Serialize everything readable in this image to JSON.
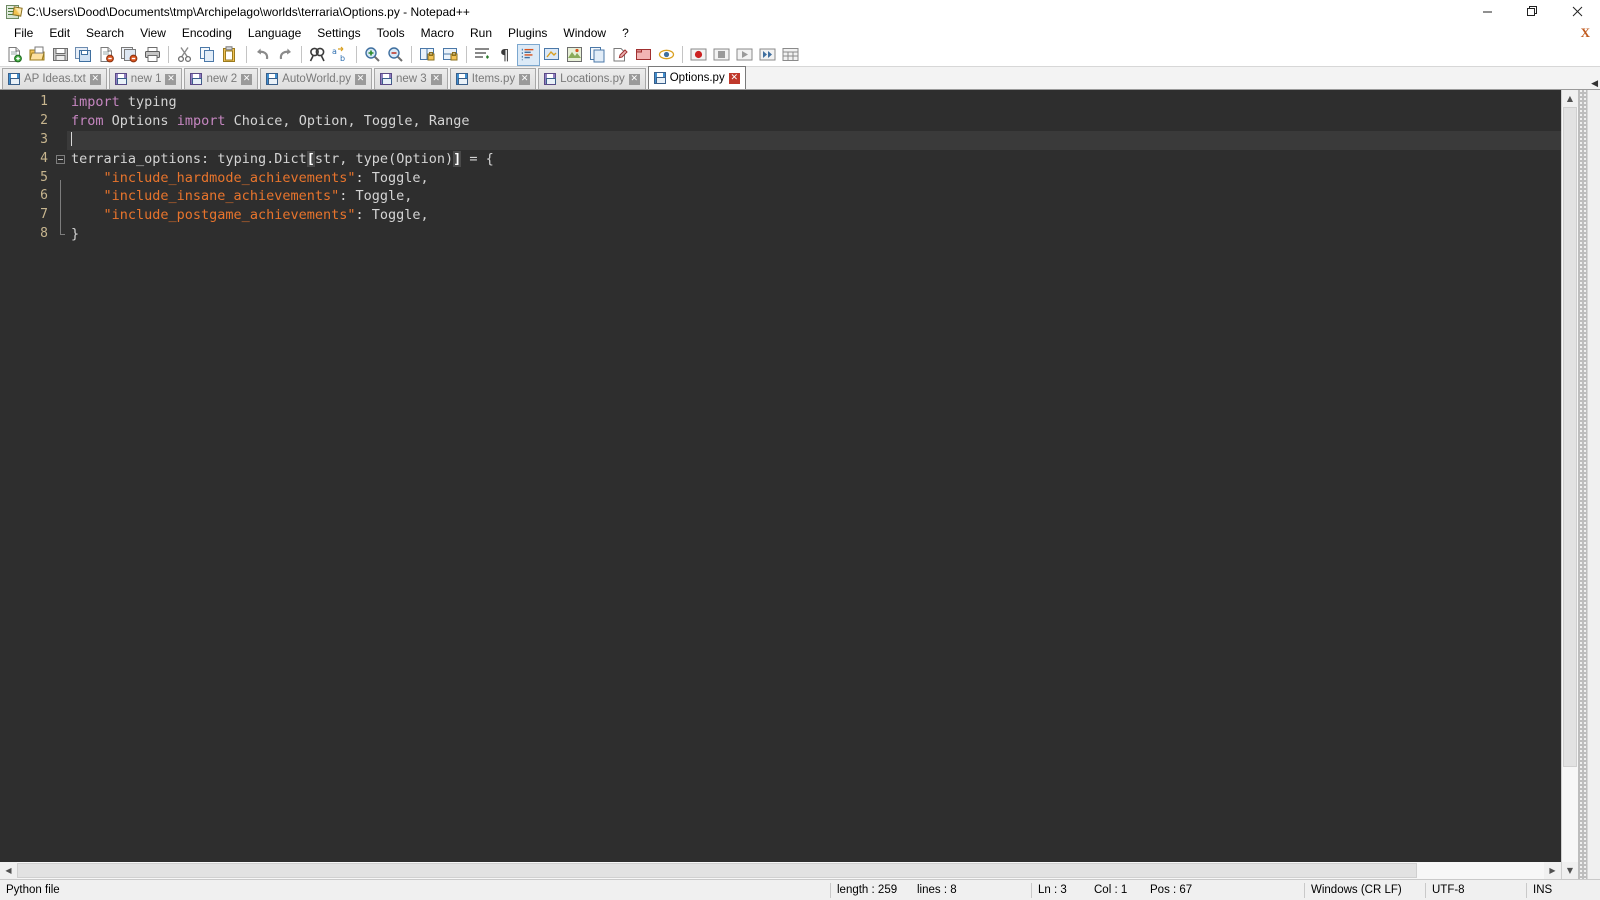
{
  "window": {
    "title": "C:\\Users\\Dood\\Documents\\tmp\\Archipelago\\worlds\\terraria\\Options.py - Notepad++",
    "app_icon": "notepad-plus-plus-icon",
    "minimize_label": "—",
    "restore_label": "❐",
    "close_label": "✕"
  },
  "menu": {
    "items": [
      {
        "label": "File"
      },
      {
        "label": "Edit"
      },
      {
        "label": "Search"
      },
      {
        "label": "View"
      },
      {
        "label": "Encoding"
      },
      {
        "label": "Language"
      },
      {
        "label": "Settings"
      },
      {
        "label": "Tools"
      },
      {
        "label": "Macro"
      },
      {
        "label": "Run"
      },
      {
        "label": "Plugins"
      },
      {
        "label": "Window"
      },
      {
        "label": "?"
      }
    ],
    "document_close_label": "X"
  },
  "toolbar": {
    "buttons": [
      {
        "name": "new-file-icon",
        "tooltip": "New"
      },
      {
        "name": "open-file-icon",
        "tooltip": "Open"
      },
      {
        "name": "save-icon",
        "tooltip": "Save"
      },
      {
        "name": "save-all-icon",
        "tooltip": "Save All"
      },
      {
        "name": "close-file-icon",
        "tooltip": "Close"
      },
      {
        "name": "close-all-files-icon",
        "tooltip": "Close All"
      },
      {
        "name": "print-icon",
        "tooltip": "Print"
      },
      {
        "name": "separator",
        "tooltip": ""
      },
      {
        "name": "cut-icon",
        "tooltip": "Cut"
      },
      {
        "name": "copy-icon",
        "tooltip": "Copy"
      },
      {
        "name": "paste-icon",
        "tooltip": "Paste"
      },
      {
        "name": "separator",
        "tooltip": ""
      },
      {
        "name": "undo-icon",
        "tooltip": "Undo"
      },
      {
        "name": "redo-icon",
        "tooltip": "Redo"
      },
      {
        "name": "separator",
        "tooltip": ""
      },
      {
        "name": "find-icon",
        "tooltip": "Find"
      },
      {
        "name": "replace-icon",
        "tooltip": "Replace"
      },
      {
        "name": "separator",
        "tooltip": ""
      },
      {
        "name": "zoom-in-icon",
        "tooltip": "Zoom In"
      },
      {
        "name": "zoom-out-icon",
        "tooltip": "Zoom Out"
      },
      {
        "name": "separator",
        "tooltip": ""
      },
      {
        "name": "sync-vertical-scroll-icon",
        "tooltip": "Synchronize Vertical Scrolling"
      },
      {
        "name": "sync-horizontal-scroll-icon",
        "tooltip": "Synchronize Horizontal Scrolling"
      },
      {
        "name": "separator",
        "tooltip": ""
      },
      {
        "name": "word-wrap-icon",
        "tooltip": "Word wrap"
      },
      {
        "name": "show-all-characters-icon",
        "tooltip": "Show All Characters"
      },
      {
        "name": "show-indent-guide-icon",
        "tooltip": "Show Indent Guide"
      },
      {
        "name": "user-defined-language-icon",
        "tooltip": "User-Defined Dialogue"
      },
      {
        "name": "document-map-icon",
        "tooltip": "Document Map"
      },
      {
        "name": "function-list-icon",
        "tooltip": "Function List"
      },
      {
        "name": "folder-as-workspace-icon",
        "tooltip": "Folder as Workspace"
      },
      {
        "name": "monitoring-icon",
        "tooltip": "Monitoring"
      },
      {
        "name": "separator",
        "tooltip": ""
      },
      {
        "name": "macro-record-icon",
        "tooltip": "Start Recording"
      },
      {
        "name": "macro-stop-icon",
        "tooltip": "Stop Recording"
      },
      {
        "name": "macro-play-icon",
        "tooltip": "Playback"
      },
      {
        "name": "macro-run-multiple-icon",
        "tooltip": "Run a Macro Multiple Times"
      },
      {
        "name": "macro-save-icon",
        "tooltip": "Save Current Recorded Macro"
      }
    ]
  },
  "tabs": {
    "items": [
      {
        "label": "AP Ideas.txt",
        "icon": "save-blue-icon",
        "active": false,
        "modified": false
      },
      {
        "label": "new 1",
        "icon": "save-purple-icon",
        "active": false,
        "modified": true
      },
      {
        "label": "new 2",
        "icon": "save-purple-icon",
        "active": false,
        "modified": true
      },
      {
        "label": "AutoWorld.py",
        "icon": "save-blue-icon",
        "active": false,
        "modified": false
      },
      {
        "label": "new 3",
        "icon": "save-purple-icon",
        "active": false,
        "modified": true
      },
      {
        "label": "Items.py",
        "icon": "save-blue-icon",
        "active": false,
        "modified": false
      },
      {
        "label": "Locations.py",
        "icon": "save-purple-icon",
        "active": false,
        "modified": false
      },
      {
        "label": "Options.py",
        "icon": "save-blue-icon",
        "active": true,
        "modified": false
      }
    ],
    "close_glyph": "✕",
    "scroll_left_glyph": "◀",
    "scroll_right_glyph": "▶"
  },
  "editor": {
    "line_numbers": [
      "1",
      "2",
      "3",
      "4",
      "5",
      "6",
      "7",
      "8"
    ],
    "current_line": 3,
    "fold_start_line": 4,
    "fold_end_line": 7,
    "lines": [
      {
        "n": 1,
        "tokens": [
          {
            "t": "import",
            "c": "kw"
          },
          {
            "t": " ",
            "c": "op"
          },
          {
            "t": "typing",
            "c": "id"
          }
        ]
      },
      {
        "n": 2,
        "tokens": [
          {
            "t": "from",
            "c": "kw"
          },
          {
            "t": " ",
            "c": "op"
          },
          {
            "t": "Options",
            "c": "id"
          },
          {
            "t": " ",
            "c": "op"
          },
          {
            "t": "import",
            "c": "kw"
          },
          {
            "t": " ",
            "c": "op"
          },
          {
            "t": "Choice",
            "c": "id"
          },
          {
            "t": ",",
            "c": "op"
          },
          {
            "t": " ",
            "c": "op"
          },
          {
            "t": "Option",
            "c": "id"
          },
          {
            "t": ",",
            "c": "op"
          },
          {
            "t": " ",
            "c": "op"
          },
          {
            "t": "Toggle",
            "c": "id"
          },
          {
            "t": ",",
            "c": "op"
          },
          {
            "t": " ",
            "c": "op"
          },
          {
            "t": "Range",
            "c": "id"
          }
        ]
      },
      {
        "n": 3,
        "tokens": []
      },
      {
        "n": 4,
        "tokens": [
          {
            "t": "terraria_options",
            "c": "id"
          },
          {
            "t": ": ",
            "c": "op"
          },
          {
            "t": "typing",
            "c": "id"
          },
          {
            "t": ".",
            "c": "op"
          },
          {
            "t": "Dict",
            "c": "id"
          },
          {
            "t": "[",
            "c": "br"
          },
          {
            "t": "str",
            "c": "id"
          },
          {
            "t": ", ",
            "c": "op"
          },
          {
            "t": "type",
            "c": "id"
          },
          {
            "t": "(",
            "c": "op"
          },
          {
            "t": "Option",
            "c": "id"
          },
          {
            "t": ")",
            "c": "op"
          },
          {
            "t": "]",
            "c": "br"
          },
          {
            "t": " = {",
            "c": "op"
          }
        ]
      },
      {
        "n": 5,
        "tokens": [
          {
            "t": "    ",
            "c": "op"
          },
          {
            "t": "\"include_hardmode_achievements\"",
            "c": "str"
          },
          {
            "t": ": ",
            "c": "op"
          },
          {
            "t": "Toggle",
            "c": "id"
          },
          {
            "t": ",",
            "c": "op"
          }
        ]
      },
      {
        "n": 6,
        "tokens": [
          {
            "t": "    ",
            "c": "op"
          },
          {
            "t": "\"include_insane_achievements\"",
            "c": "str"
          },
          {
            "t": ": ",
            "c": "op"
          },
          {
            "t": "Toggle",
            "c": "id"
          },
          {
            "t": ",",
            "c": "op"
          }
        ]
      },
      {
        "n": 7,
        "tokens": [
          {
            "t": "    ",
            "c": "op"
          },
          {
            "t": "\"include_postgame_achievements\"",
            "c": "str"
          },
          {
            "t": ": ",
            "c": "op"
          },
          {
            "t": "Toggle",
            "c": "id"
          },
          {
            "t": ",",
            "c": "op"
          }
        ]
      },
      {
        "n": 8,
        "tokens": [
          {
            "t": "}",
            "c": "op"
          }
        ]
      }
    ],
    "colors": {
      "background": "#2e2e2e",
      "current_line": "#3a3a3a",
      "line_number": "#c8b68f",
      "keyword": "#c586c0",
      "identifier": "#d4d4d4",
      "string": "#e8742c",
      "bracket_match": "#ffffff"
    }
  },
  "scrollbars": {
    "v_up_glyph": "▲",
    "v_down_glyph": "▼",
    "h_left_glyph": "◀",
    "h_right_glyph": "▶"
  },
  "statusbar": {
    "file_type": "Python file",
    "length_label": "length : 259",
    "lines_label": "lines : 8",
    "ln": "Ln : 3",
    "col": "Col : 1",
    "pos": "Pos : 67",
    "eol": "Windows (CR LF)",
    "encoding": "UTF-8",
    "insert_mode": "INS"
  }
}
